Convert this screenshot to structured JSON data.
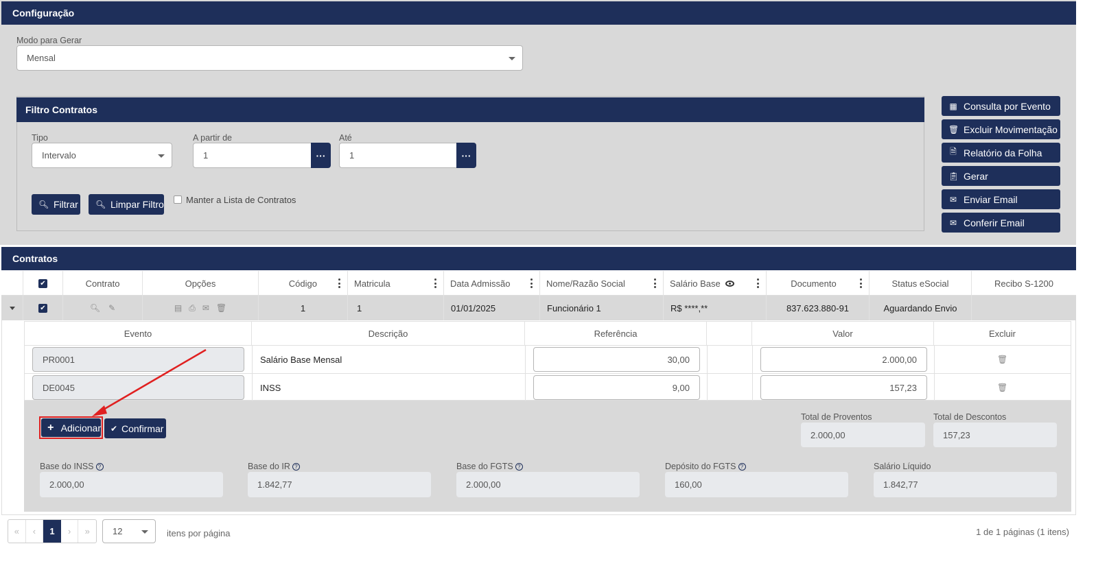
{
  "config": {
    "title": "Configuração",
    "modo_label": "Modo para Gerar",
    "modo_value": "Mensal"
  },
  "filtro": {
    "title": "Filtro Contratos",
    "tipo_label": "Tipo",
    "tipo_value": "Intervalo",
    "apartir_label": "A partir de",
    "apartir_value": "1",
    "ate_label": "Até",
    "ate_value": "1",
    "filtrar": "Filtrar",
    "limpar": "Limpar Filtro",
    "manter": "Manter a Lista de Contratos"
  },
  "side_buttons": {
    "consulta": "Consulta por Evento",
    "excluir": "Excluir Movimentação",
    "relatorio": "Relatório da Folha",
    "gerar": "Gerar",
    "enviar": "Enviar Email",
    "conferir": "Conferir Email"
  },
  "contratos": {
    "title": "Contratos",
    "headers": {
      "contrato": "Contrato",
      "opcoes": "Opções",
      "codigo": "Código",
      "matricula": "Matricula",
      "admissao": "Data Admissão",
      "nome": "Nome/Razão Social",
      "salario": "Salário Base",
      "documento": "Documento",
      "status": "Status eSocial",
      "recibo": "Recibo S-1200"
    },
    "row": {
      "codigo": "1",
      "matricula": "1",
      "admissao": "01/01/2025",
      "nome": "Funcionário 1",
      "salario": "R$ ****,**",
      "documento": "837.623.880-91",
      "status": "Aguardando Envio",
      "recibo": ""
    }
  },
  "eventos": {
    "headers": {
      "evento": "Evento",
      "descricao": "Descrição",
      "referencia": "Referência",
      "valor": "Valor",
      "excluir": "Excluir"
    },
    "rows": [
      {
        "evento": "PR0001",
        "descricao": "Salário Base Mensal",
        "referencia": "30,00",
        "valor": "2.000,00"
      },
      {
        "evento": "DE0045",
        "descricao": "INSS",
        "referencia": "9,00",
        "valor": "157,23"
      }
    ],
    "adicionar": "Adicionar",
    "confirmar": "Confirmar",
    "total_proventos_label": "Total de Proventos",
    "total_proventos": "2.000,00",
    "total_descontos_label": "Total de Descontos",
    "total_descontos": "157,23"
  },
  "bases": {
    "inss_label": "Base do INSS",
    "inss": "2.000,00",
    "ir_label": "Base do IR",
    "ir": "1.842,77",
    "fgts_label": "Base do FGTS",
    "fgts": "2.000,00",
    "deposito_label": "Depósito do FGTS",
    "deposito": "160,00",
    "liquido_label": "Salário Líquido",
    "liquido": "1.842,77"
  },
  "pager": {
    "current_page": "1",
    "page_size": "12",
    "per_page_label": "itens por página",
    "summary": "1 de 1 páginas (1 itens)"
  },
  "colors": {
    "navy": "#1e2f5a",
    "panel_gray": "#d9d9d9",
    "highlight_red": "#e02020"
  }
}
